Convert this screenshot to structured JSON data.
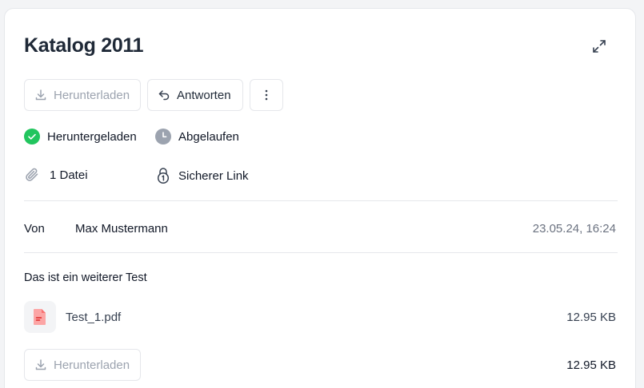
{
  "header": {
    "title": "Katalog 2011",
    "expand_icon": "expand-icon"
  },
  "toolbar": {
    "download_label": "Herunterladen",
    "reply_label": "Antworten",
    "more_icon": "more-vertical-icon"
  },
  "status": {
    "downloaded": "Heruntergeladen",
    "expired": "Abgelaufen",
    "files": "1 Datei",
    "secure_link": "Sicherer Link",
    "colors": {
      "downloaded": "#22c55e",
      "expired": "#9ca3af"
    }
  },
  "message": {
    "from_label": "Von",
    "sender": "Max Mustermann",
    "timestamp": "23.05.24, 16:24",
    "body": "Das ist ein weiterer Test"
  },
  "attachments": [
    {
      "name": "Test_1.pdf",
      "size": "12.95 KB",
      "icon": "pdf-file-icon"
    }
  ],
  "footer": {
    "download_label": "Herunterladen",
    "total_size": "12.95 KB"
  }
}
